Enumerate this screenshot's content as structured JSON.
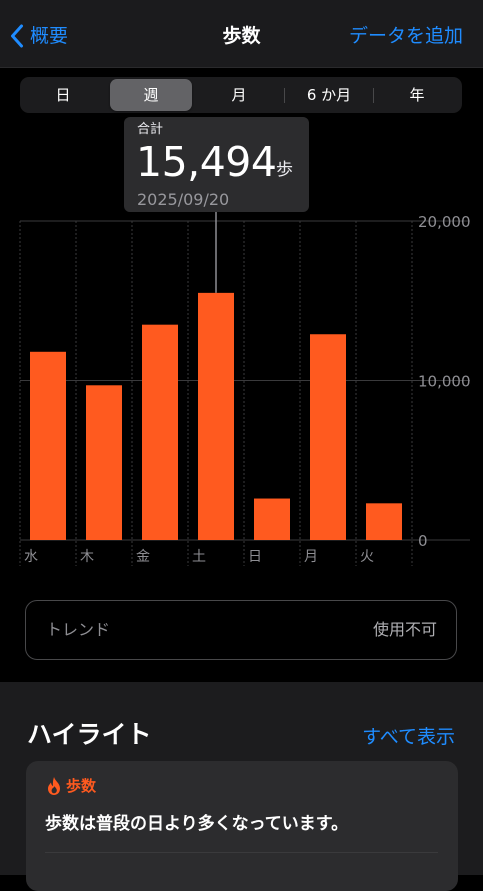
{
  "header": {
    "back_label": "概要",
    "title": "歩数",
    "add_data_label": "データを追加"
  },
  "segments": [
    {
      "label": "日",
      "active": false
    },
    {
      "label": "週",
      "active": true
    },
    {
      "label": "月",
      "active": false
    },
    {
      "label": "6 か月",
      "active": false
    },
    {
      "label": "年",
      "active": false
    }
  ],
  "tooltip": {
    "label": "合計",
    "value": "15,494",
    "unit": "歩",
    "date": "2025/09/20",
    "selected_index": 3
  },
  "chart_data": {
    "type": "bar",
    "categories": [
      "水",
      "木",
      "金",
      "土",
      "日",
      "月",
      "火"
    ],
    "values": [
      11800,
      9700,
      13500,
      15494,
      2600,
      12900,
      2300
    ],
    "ylim": [
      0,
      20000
    ],
    "yticks": [
      {
        "value": 0,
        "label": "0"
      },
      {
        "value": 10000,
        "label": "10,000"
      },
      {
        "value": 20000,
        "label": "20,000"
      }
    ],
    "grid": true,
    "bar_color": "#ff5a1f"
  },
  "trend": {
    "label": "トレンド",
    "status": "使用不可"
  },
  "highlights": {
    "title": "ハイライト",
    "show_all_label": "すべて表示",
    "card": {
      "category": "歩数",
      "text": "歩数は普段の日より多くなっています。"
    }
  },
  "colors": {
    "accent": "#1f8cff",
    "bar": "#ff5a1f",
    "background": "#000000"
  }
}
